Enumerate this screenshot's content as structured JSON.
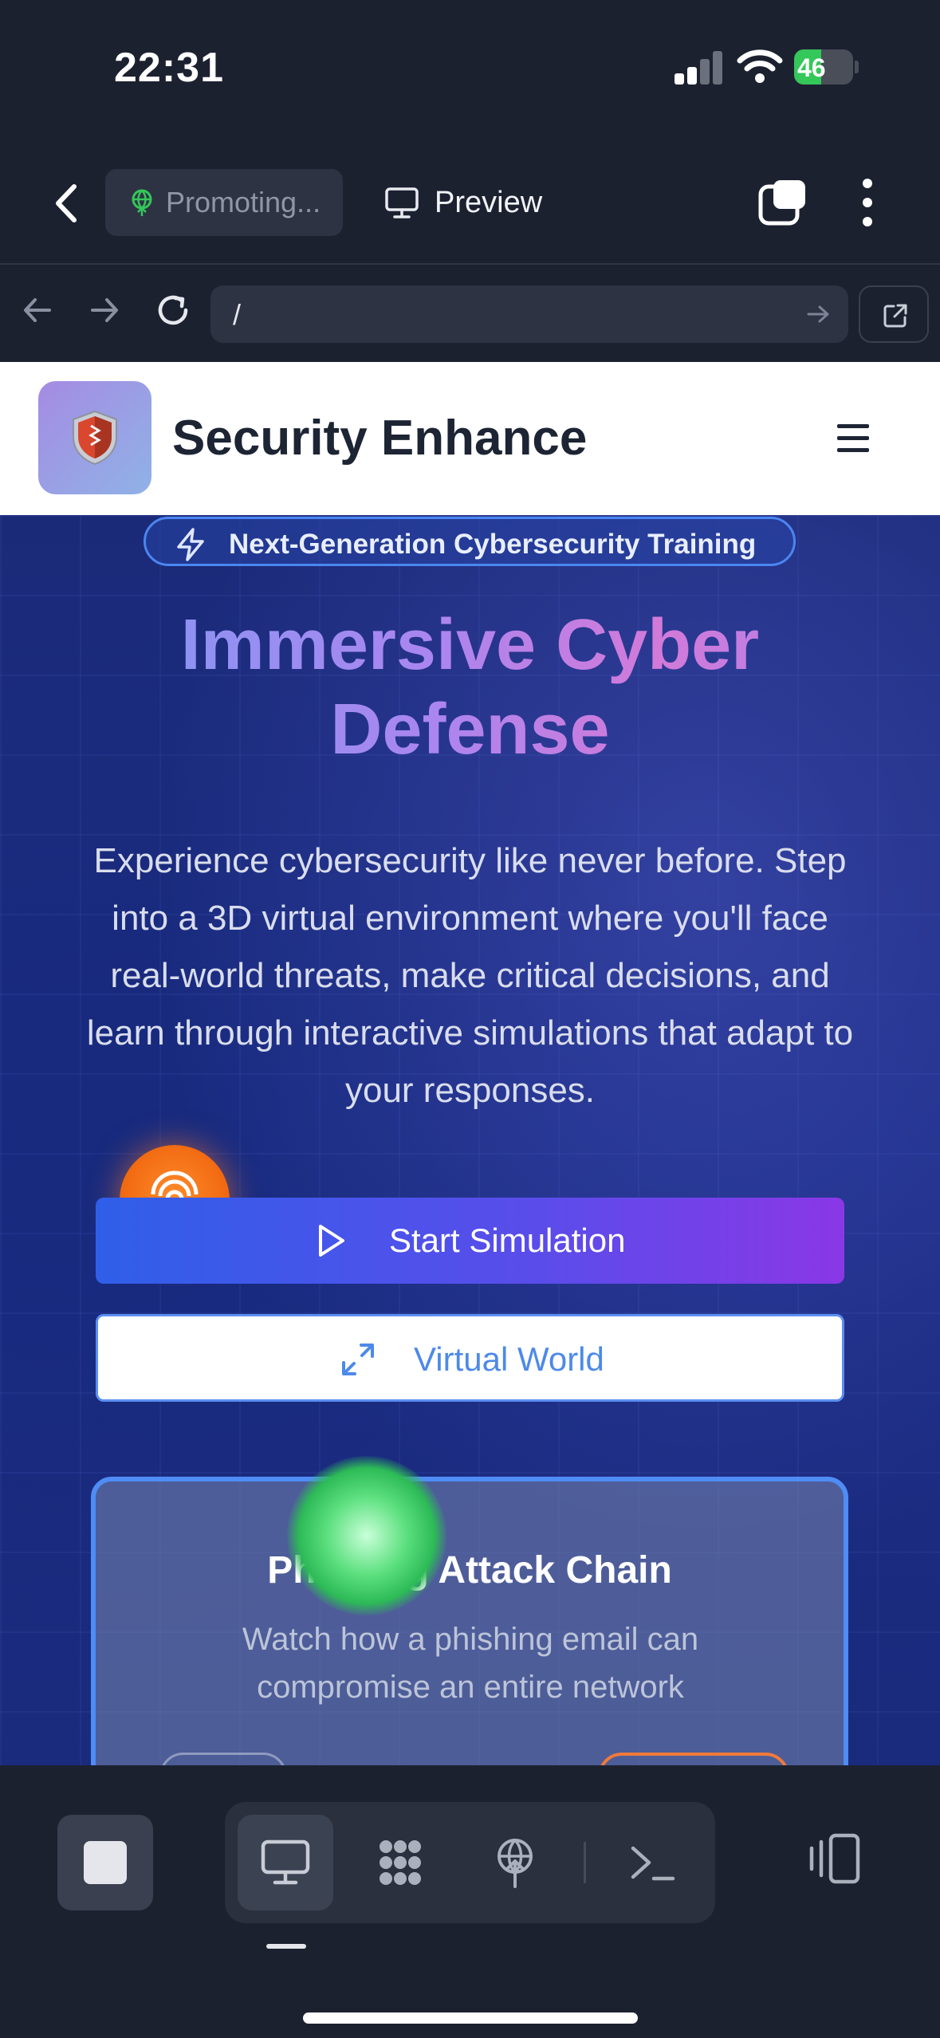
{
  "status_bar": {
    "time": "22:31",
    "battery_level": "46",
    "battery_color": "#34c759"
  },
  "toolbar": {
    "project_label": "Promoting...",
    "preview_label": "Preview"
  },
  "address_bar": {
    "url": "/"
  },
  "site": {
    "title": "Security Enhance",
    "badge": "Next-Generation Cybersecurity Training",
    "hero_title_line1": "Immersive Cyber",
    "hero_title_line2": "Defense",
    "hero_description": "Experience cybersecurity like never before. Step into a 3D virtual environment where you'll face real-world threats, make critical decisions, and learn through interactive simulations that adapt to your responses.",
    "primary_button": "Start Simulation",
    "secondary_button": "Virtual World",
    "card": {
      "title": "Phishing Attack Chain",
      "description": "Watch how a phishing email can compromise an entire network"
    }
  },
  "bottom_bar": {
    "tools": [
      {
        "name": "preview",
        "icon": "monitor-icon",
        "active": true
      },
      {
        "name": "components",
        "icon": "blocks-icon",
        "active": false
      },
      {
        "name": "publish",
        "icon": "globe-upload-icon",
        "active": false
      },
      {
        "name": "terminal",
        "icon": "terminal-icon",
        "active": false
      }
    ]
  },
  "colors": {
    "app_background": "#1c2130",
    "hero_background": "#1c2d86",
    "primary_gradient_start": "#2f5fe9",
    "primary_gradient_end": "#8a37e6",
    "accent_blue": "#4d8ae8"
  }
}
